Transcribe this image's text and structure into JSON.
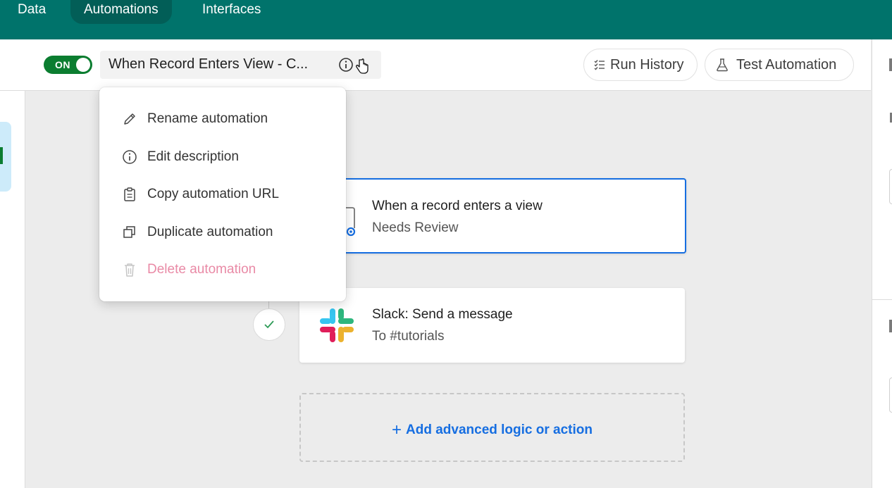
{
  "nav": {
    "tabs": [
      {
        "label": "Data"
      },
      {
        "label": "Automations"
      },
      {
        "label": "Interfaces"
      }
    ],
    "active": "Automations"
  },
  "header": {
    "toggle_label": "ON",
    "automation_title": "When Record Enters View - C...",
    "run_history_label": "Run History",
    "test_automation_label": "Test Automation"
  },
  "menu": {
    "items": [
      {
        "label": "Rename automation",
        "icon": "pencil-icon"
      },
      {
        "label": "Edit description",
        "icon": "info-icon"
      },
      {
        "label": "Copy automation URL",
        "icon": "clipboard-icon"
      },
      {
        "label": "Duplicate automation",
        "icon": "duplicate-icon"
      },
      {
        "label": "Delete automation",
        "icon": "trash-icon"
      }
    ]
  },
  "trigger": {
    "title": "When a record enters a view",
    "subtitle": "Needs Review"
  },
  "action": {
    "title": "Slack: Send a message",
    "subtitle": "To #tutorials"
  },
  "add_step": {
    "label": "Add advanced logic or action"
  },
  "colors": {
    "topbar": "#00736b",
    "toggle_on": "#0b7d30",
    "accent_blue": "#166ee1",
    "danger_pink": "#e98aa6"
  }
}
